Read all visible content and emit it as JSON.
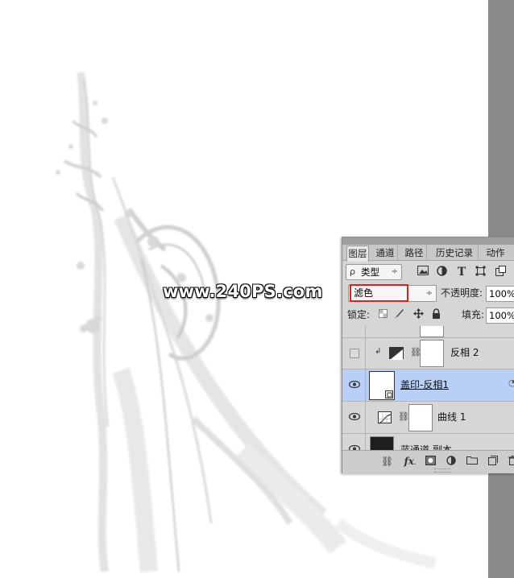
{
  "watermark": "www.240PS.com",
  "tabs": [
    {
      "label": "图层"
    },
    {
      "label": "通道"
    },
    {
      "label": "路径"
    },
    {
      "label": "历史记录"
    },
    {
      "label": "动作"
    }
  ],
  "filter": {
    "search_glyph": "ρ",
    "kind_label": "类型",
    "kind_arrow": "÷",
    "icons": [
      "image-filter-icon",
      "adjustment-filter-icon",
      "type-filter-icon",
      "shape-filter-icon",
      "smart-object-filter-icon"
    ]
  },
  "blend": {
    "mode": "滤色",
    "arrow": "÷",
    "opacity_label": "不透明度:",
    "opacity_value": "100%"
  },
  "lock": {
    "label": "锁定:",
    "fill_label": "填充:",
    "fill_value": "100%"
  },
  "layers": [
    {
      "name": "",
      "visible": false,
      "partial": true
    },
    {
      "name": "反相 2",
      "visible": false,
      "clipped": true,
      "type": "invert-adjustment"
    },
    {
      "name": "盖印-反相1",
      "visible": true,
      "selected": true,
      "type": "smart-object"
    },
    {
      "name": "曲线 1",
      "visible": true,
      "type": "curves-adjustment"
    },
    {
      "name": "蓝通道 副本",
      "visible": true,
      "partial": true
    }
  ],
  "colors": {
    "selection": "#b9cff5",
    "highlight_box": "#e02020",
    "gutter": "#8a8a8a"
  }
}
